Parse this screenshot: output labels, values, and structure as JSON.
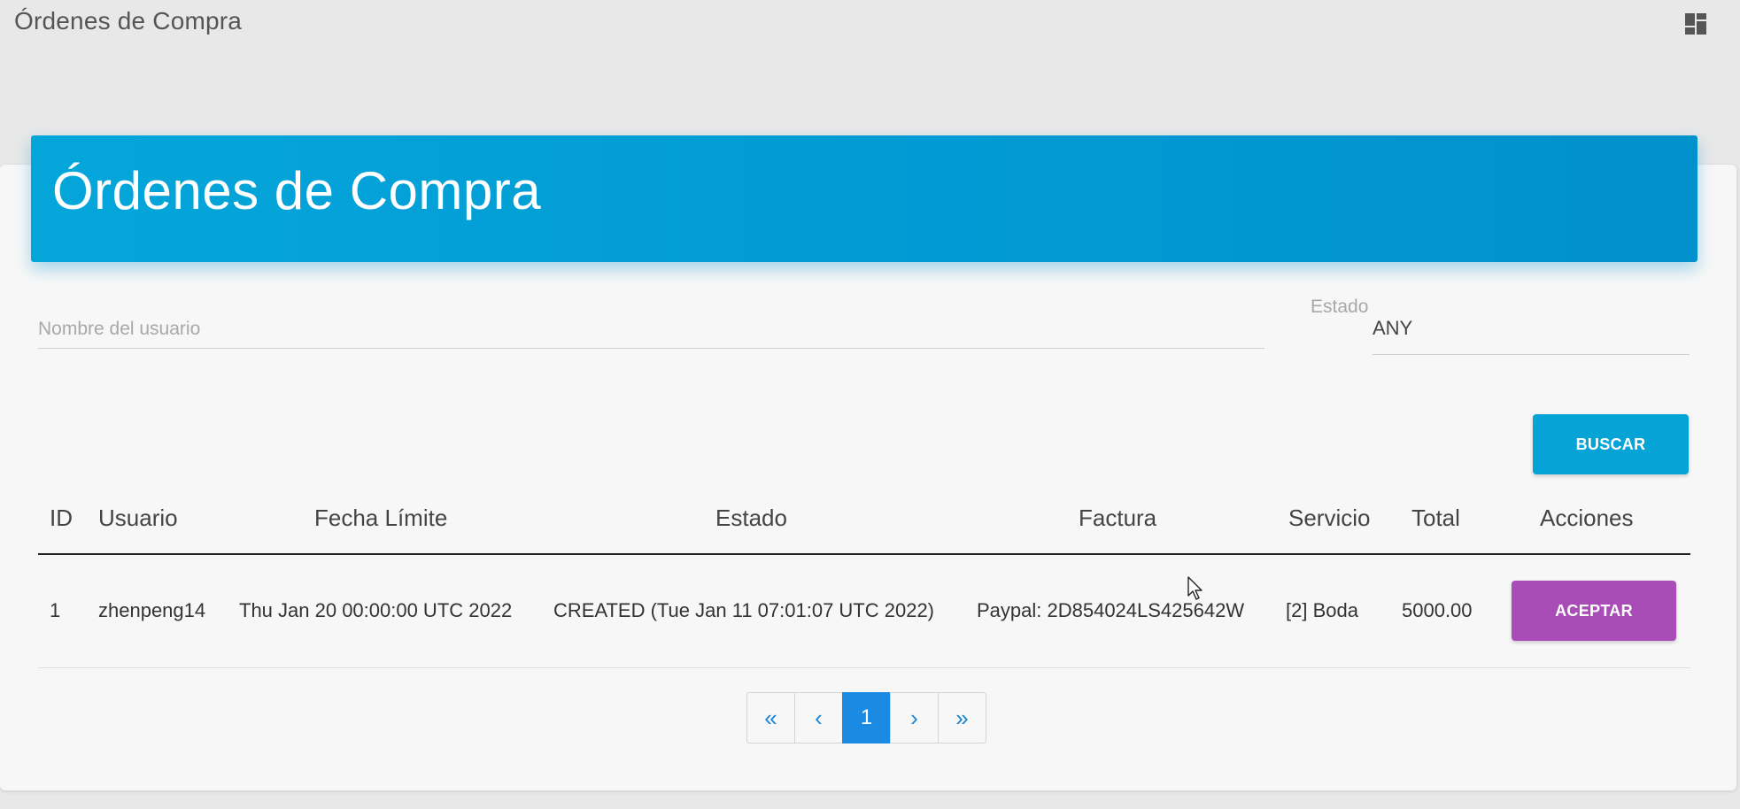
{
  "topbar": {
    "title": "Órdenes de Compra",
    "dashboard_icon": "dashboard-icon"
  },
  "card": {
    "title": "Órdenes de Compra"
  },
  "filters": {
    "user_placeholder": "Nombre del usuario",
    "user_value": "",
    "estado_label": "Estado",
    "estado_value": "ANY",
    "buscar_label": "BUSCAR"
  },
  "table": {
    "headers": [
      "ID",
      "Usuario",
      "Fecha Límite",
      "Estado",
      "Factura",
      "Servicio",
      "Total",
      "Acciones"
    ],
    "rows": [
      {
        "id": "1",
        "usuario": "zhenpeng14",
        "fecha_limite": "Thu Jan 20 00:00:00 UTC 2022",
        "estado": "CREATED (Tue Jan 11 07:01:07 UTC 2022)",
        "factura": "Paypal: 2D854024LS425642W",
        "servicio": "[2] Boda",
        "total": "5000.00",
        "accion_label": "ACEPTAR"
      }
    ]
  },
  "pagination": {
    "first": "«",
    "prev": "‹",
    "current": "1",
    "next": "›",
    "last": "»"
  },
  "colors": {
    "header_blue": "#04a6da",
    "buscar_button": "#05a3d6",
    "aceptar_button": "#a94cb8",
    "active_page": "#1a8ae3"
  }
}
